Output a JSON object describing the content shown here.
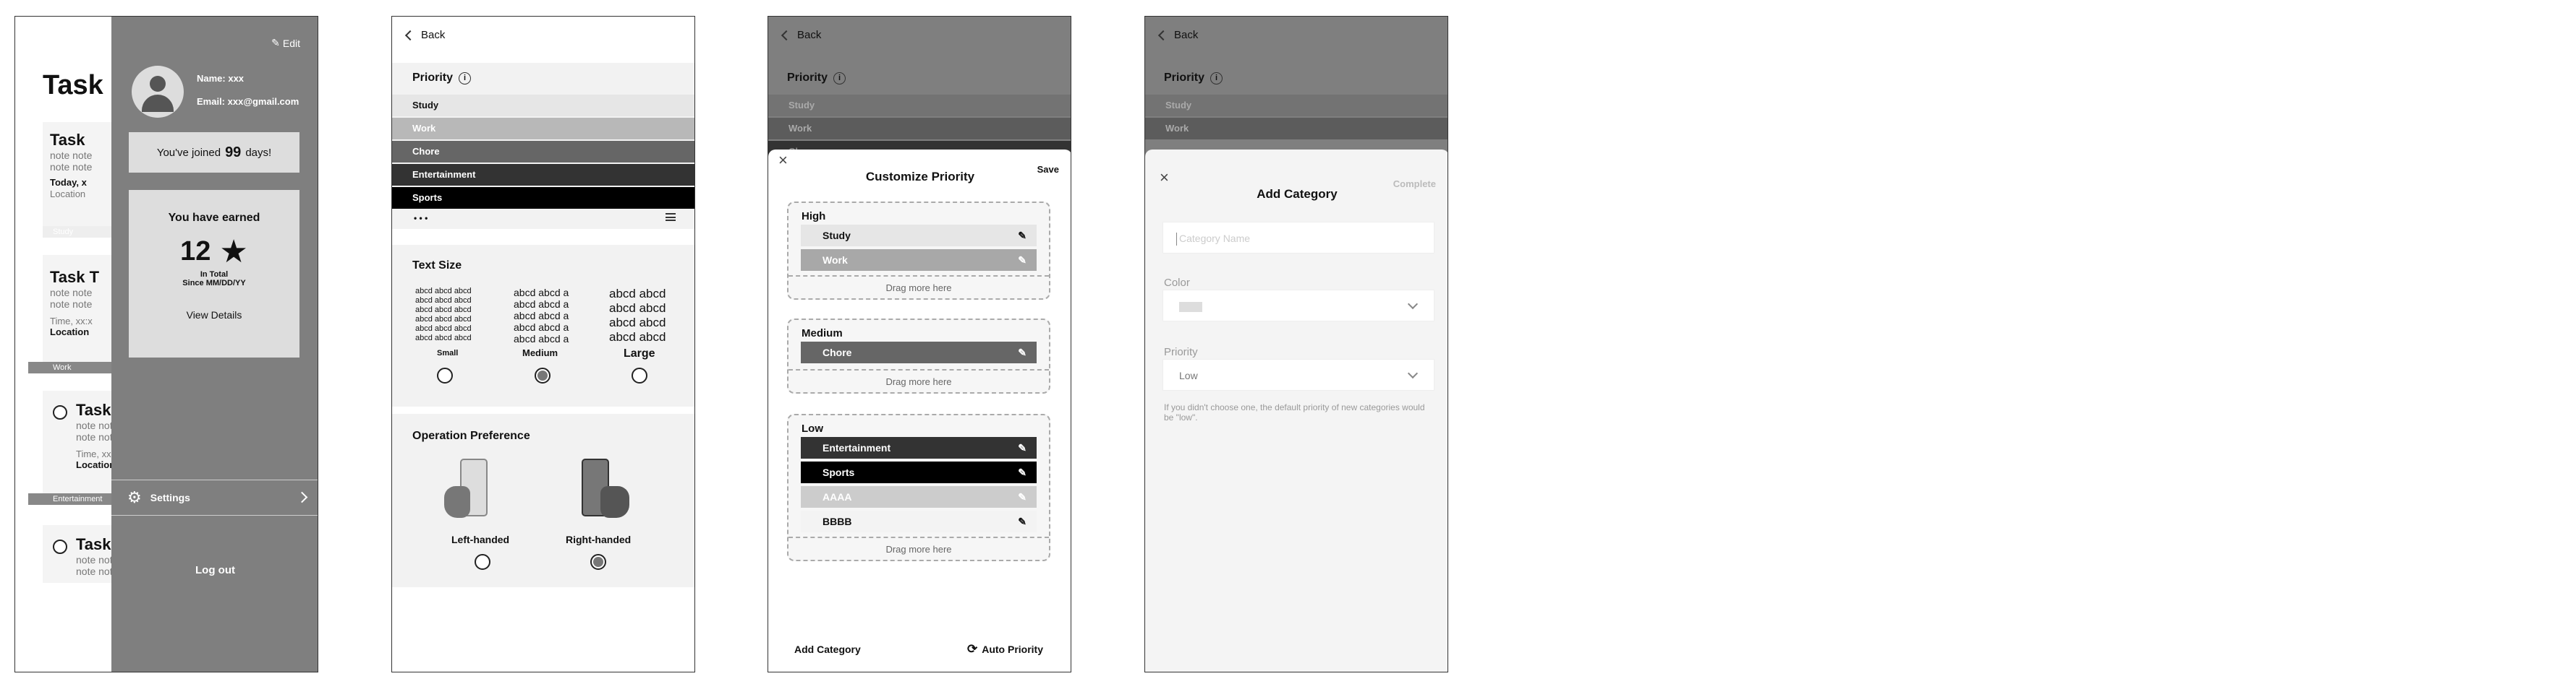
{
  "screen1": {
    "page_title": "Task",
    "edit_label": "Edit",
    "name": "Name: xxx",
    "email": "Email: xxx@gmail.com",
    "joined_prefix": "You've joined",
    "joined_days": "99",
    "joined_suffix": "days!",
    "earned_title": "You have earned",
    "earned_count": "12",
    "in_total": "In Total",
    "since": "Since MM/DD/YY",
    "view_details": "View Details",
    "settings": "Settings",
    "logout": "Log out",
    "tasks": [
      {
        "title": "Task",
        "notes": [
          "note note",
          "note note"
        ],
        "bold": "Today, x",
        "meta": "Location",
        "tag": "Study"
      },
      {
        "title": "Task T",
        "notes": [
          "note note",
          "note note"
        ],
        "bold": "",
        "meta": "Time, xx:x",
        "meta2": "Location",
        "tag": "Work"
      },
      {
        "title": "Task",
        "notes": [
          "note note",
          "note note"
        ],
        "bold": "",
        "meta": "Time, xx:x",
        "meta2": "Location",
        "tag": "Entertainment"
      },
      {
        "title": "Task",
        "notes": [
          "note note",
          "note note"
        ]
      }
    ]
  },
  "screen2": {
    "back": "Back",
    "priority_title": "Priority",
    "info": "i",
    "priorities": [
      "Study",
      "Work",
      "Chore",
      "Entertainment",
      "Sports"
    ],
    "more": "• • •",
    "text_size_title": "Text Size",
    "sample": "abcd abcd abcd",
    "sample_medium": "abcd abcd a",
    "sample_large": "abcd abcd",
    "small": "Small",
    "medium": "Medium",
    "large": "Large",
    "operation_title": "Operation Preference",
    "left_handed": "Left-handed",
    "right_handed": "Right-handed"
  },
  "screen3": {
    "back": "Back",
    "priority_title": "Priority",
    "info": "i",
    "priorities": [
      "Study",
      "Work",
      "Chore",
      "Entertainment",
      "Sports"
    ],
    "modal_title": "Customize Priority",
    "save": "Save",
    "close": "×",
    "high": "High",
    "medium": "Medium",
    "low": "Low",
    "high_items": [
      "Study",
      "Work"
    ],
    "medium_items": [
      "Chore"
    ],
    "low_items": [
      "Entertainment",
      "Sports",
      "AAAA",
      "BBBB"
    ],
    "drag_more": "Drag more here",
    "add_category": "Add Category",
    "auto_priority": "Auto Priority"
  },
  "screen4": {
    "back": "Back",
    "priority_title": "Priority",
    "info": "i",
    "priorities": [
      "Study",
      "Work"
    ],
    "modal_title": "Add Category",
    "complete": "Complete",
    "close": "×",
    "name_placeholder": "Category Name",
    "color_label": "Color",
    "priority_label": "Priority",
    "priority_value": "Low",
    "hint": "If you didn't choose one, the default priority of new categories would be \"low\"."
  }
}
